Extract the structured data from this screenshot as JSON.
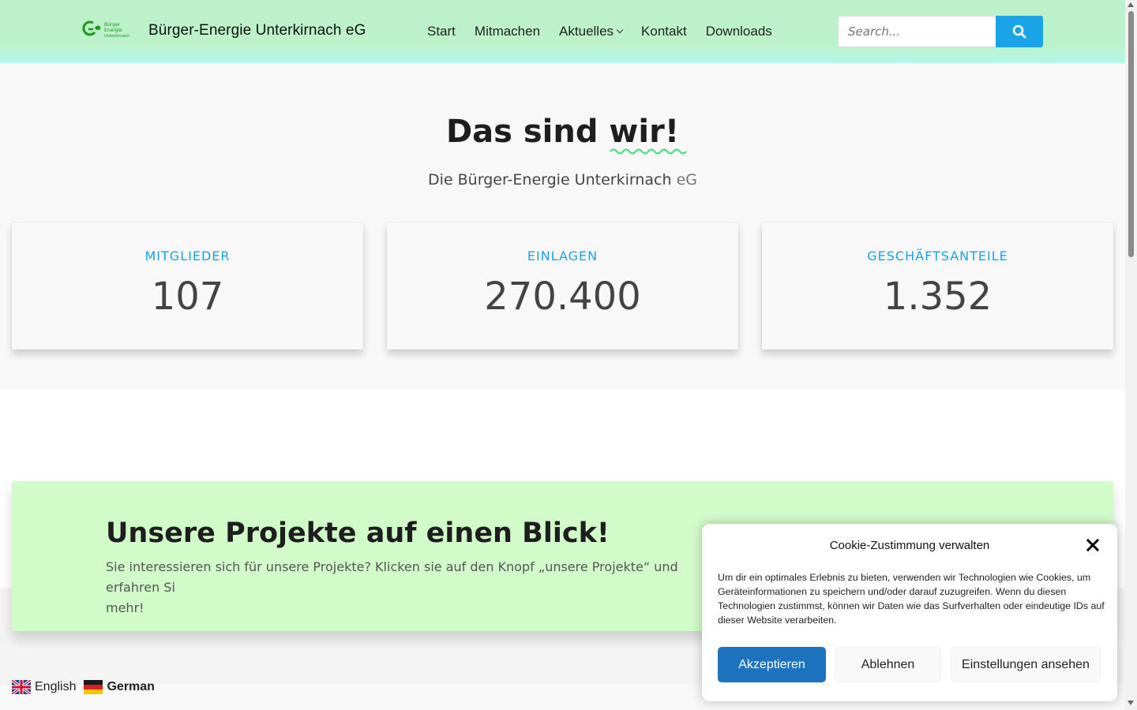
{
  "header": {
    "logo_text": [
      "Bürger",
      "Energie",
      "Unterkirnach"
    ],
    "site_title": "Bürger-Energie Unterkirnach eG",
    "nav": [
      "Start",
      "Mitmachen",
      "Aktuelles",
      "Kontakt",
      "Downloads"
    ],
    "search_placeholder": "Search..."
  },
  "hero": {
    "title_part1": "Das sind ",
    "title_part2": "wir!",
    "subtitle_main": "Die Bürger-Energie Unterkirnach ",
    "subtitle_suffix": "eG",
    "stats": [
      {
        "label": "MITGLIEDER",
        "value": "107"
      },
      {
        "label": "EINLAGEN",
        "value": "270.400"
      },
      {
        "label": "GESCHÄFTSANTEILE",
        "value": "1.352"
      }
    ]
  },
  "projects": {
    "title": "Unsere Projekte auf einen Blick!",
    "text": "Sie interessieren sich für unsere Projekte? Klicken sie auf den Knopf „unsere Projekte“ und erfahren Si",
    "text_line2": "mehr!"
  },
  "languages": [
    {
      "label": "English",
      "active": false
    },
    {
      "label": "German",
      "active": true
    }
  ],
  "cookie": {
    "title": "Cookie-Zustimmung verwalten",
    "text": "Um dir ein optimales Erlebnis zu bieten, verwenden wir Technologien wie Cookies, um Geräteinformationen zu speichern und/oder darauf zuzugreifen. Wenn du diesen Technologien zustimmst, können wir Daten wie das Surfverhalten oder eindeutige IDs auf dieser Website verarbeiten.",
    "accept": "Akzeptieren",
    "decline": "Ablehnen",
    "settings": "Einstellungen ansehen"
  },
  "colors": {
    "accent_blue": "#1ba3e8",
    "header_green": "#bdf1c9",
    "banner_green": "#d2fbca",
    "cookie_accept": "#1e73be",
    "logo_green": "#1a9a1a"
  }
}
